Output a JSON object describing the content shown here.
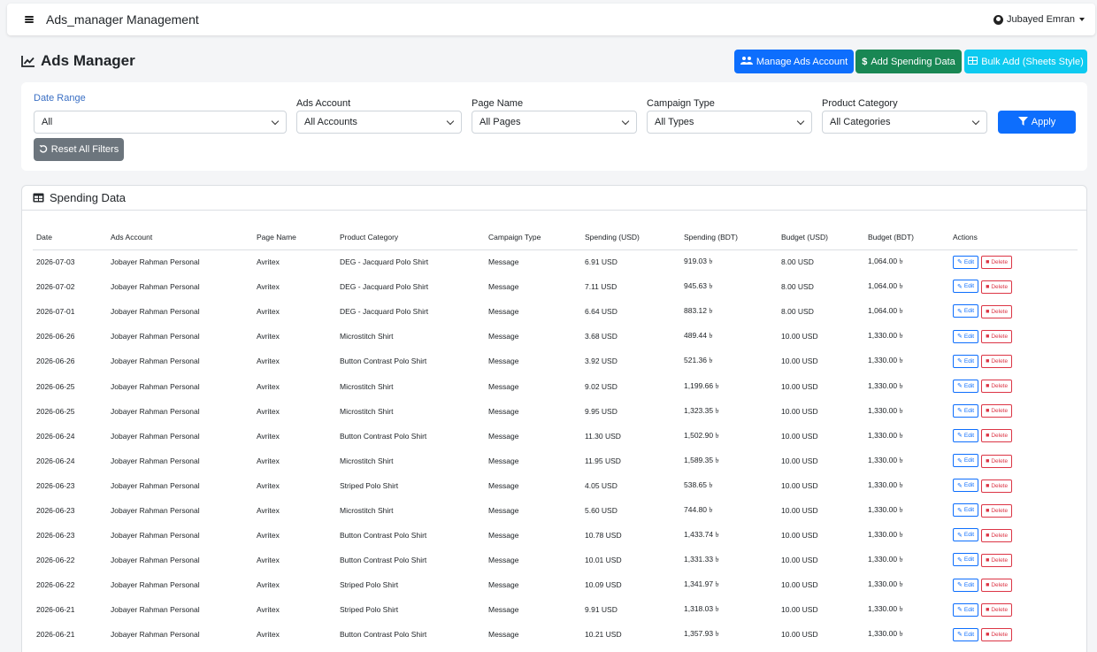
{
  "app": {
    "title": "Ads_manager Management",
    "user": "Jubayed Emran"
  },
  "page": {
    "title": "Ads Manager"
  },
  "actions": {
    "manage": "Manage Ads Account",
    "add": "Add Spending Data",
    "bulk": "Bulk Add (Sheets Style)"
  },
  "filters": {
    "date_range": {
      "label": "Date Range",
      "value": "All"
    },
    "ads_account": {
      "label": "Ads Account",
      "value": "All Accounts"
    },
    "page_name": {
      "label": "Page Name",
      "value": "All Pages"
    },
    "campaign_type": {
      "label": "Campaign Type",
      "value": "All Types"
    },
    "product_category": {
      "label": "Product Category",
      "value": "All Categories"
    },
    "apply": "Apply",
    "reset": "Reset All Filters"
  },
  "spending": {
    "title": "Spending Data",
    "columns": [
      "Date",
      "Ads Account",
      "Page Name",
      "Product Category",
      "Campaign Type",
      "Spending (USD)",
      "Spending (BDT)",
      "Budget (USD)",
      "Budget (BDT)",
      "Actions"
    ],
    "edit_label": "Edit",
    "delete_label": "Delete",
    "rows": [
      [
        "2026-07-03",
        "Jobayer Rahman Personal",
        "Avritex",
        "DEG - Jacquard Polo Shirt",
        "Message",
        "6.91 USD",
        "919.03 ৳",
        "8.00 USD",
        "1,064.00 ৳"
      ],
      [
        "2026-07-02",
        "Jobayer Rahman Personal",
        "Avritex",
        "DEG - Jacquard Polo Shirt",
        "Message",
        "7.11 USD",
        "945.63 ৳",
        "8.00 USD",
        "1,064.00 ৳"
      ],
      [
        "2026-07-01",
        "Jobayer Rahman Personal",
        "Avritex",
        "DEG - Jacquard Polo Shirt",
        "Message",
        "6.64 USD",
        "883.12 ৳",
        "8.00 USD",
        "1,064.00 ৳"
      ],
      [
        "2026-06-26",
        "Jobayer Rahman Personal",
        "Avritex",
        "Microstitch Shirt",
        "Message",
        "3.68 USD",
        "489.44 ৳",
        "10.00 USD",
        "1,330.00 ৳"
      ],
      [
        "2026-06-26",
        "Jobayer Rahman Personal",
        "Avritex",
        "Button Contrast Polo Shirt",
        "Message",
        "3.92 USD",
        "521.36 ৳",
        "10.00 USD",
        "1,330.00 ৳"
      ],
      [
        "2026-06-25",
        "Jobayer Rahman Personal",
        "Avritex",
        "Microstitch Shirt",
        "Message",
        "9.02 USD",
        "1,199.66 ৳",
        "10.00 USD",
        "1,330.00 ৳"
      ],
      [
        "2026-06-25",
        "Jobayer Rahman Personal",
        "Avritex",
        "Microstitch Shirt",
        "Message",
        "9.95 USD",
        "1,323.35 ৳",
        "10.00 USD",
        "1,330.00 ৳"
      ],
      [
        "2026-06-24",
        "Jobayer Rahman Personal",
        "Avritex",
        "Button Contrast Polo Shirt",
        "Message",
        "11.30 USD",
        "1,502.90 ৳",
        "10.00 USD",
        "1,330.00 ৳"
      ],
      [
        "2026-06-24",
        "Jobayer Rahman Personal",
        "Avritex",
        "Microstitch Shirt",
        "Message",
        "11.95 USD",
        "1,589.35 ৳",
        "10.00 USD",
        "1,330.00 ৳"
      ],
      [
        "2026-06-23",
        "Jobayer Rahman Personal",
        "Avritex",
        "Striped Polo Shirt",
        "Message",
        "4.05 USD",
        "538.65 ৳",
        "10.00 USD",
        "1,330.00 ৳"
      ],
      [
        "2026-06-23",
        "Jobayer Rahman Personal",
        "Avritex",
        "Microstitch Shirt",
        "Message",
        "5.60 USD",
        "744.80 ৳",
        "10.00 USD",
        "1,330.00 ৳"
      ],
      [
        "2026-06-23",
        "Jobayer Rahman Personal",
        "Avritex",
        "Button Contrast Polo Shirt",
        "Message",
        "10.78 USD",
        "1,433.74 ৳",
        "10.00 USD",
        "1,330.00 ৳"
      ],
      [
        "2026-06-22",
        "Jobayer Rahman Personal",
        "Avritex",
        "Button Contrast Polo Shirt",
        "Message",
        "10.01 USD",
        "1,331.33 ৳",
        "10.00 USD",
        "1,330.00 ৳"
      ],
      [
        "2026-06-22",
        "Jobayer Rahman Personal",
        "Avritex",
        "Striped Polo Shirt",
        "Message",
        "10.09 USD",
        "1,341.97 ৳",
        "10.00 USD",
        "1,330.00 ৳"
      ],
      [
        "2026-06-21",
        "Jobayer Rahman Personal",
        "Avritex",
        "Striped Polo Shirt",
        "Message",
        "9.91 USD",
        "1,318.03 ৳",
        "10.00 USD",
        "1,330.00 ৳"
      ],
      [
        "2026-06-21",
        "Jobayer Rahman Personal",
        "Avritex",
        "Button Contrast Polo Shirt",
        "Message",
        "10.21 USD",
        "1,357.93 ৳",
        "10.00 USD",
        "1,330.00 ৳"
      ]
    ]
  },
  "icons": {
    "menu": "hamburger-icon",
    "user": "user-circle-icon",
    "chart": "chart-line-icon",
    "users": "users-icon",
    "dollar": "dollar-icon",
    "table": "table-icon",
    "filter": "filter-icon",
    "undo": "undo-icon",
    "edit": "edit-icon",
    "delete": "trash-icon"
  },
  "colors": {
    "primary": "#0d6efd",
    "success": "#198754",
    "info": "#0dcaf0",
    "secondary": "#6c757d",
    "danger": "#dc3545"
  }
}
